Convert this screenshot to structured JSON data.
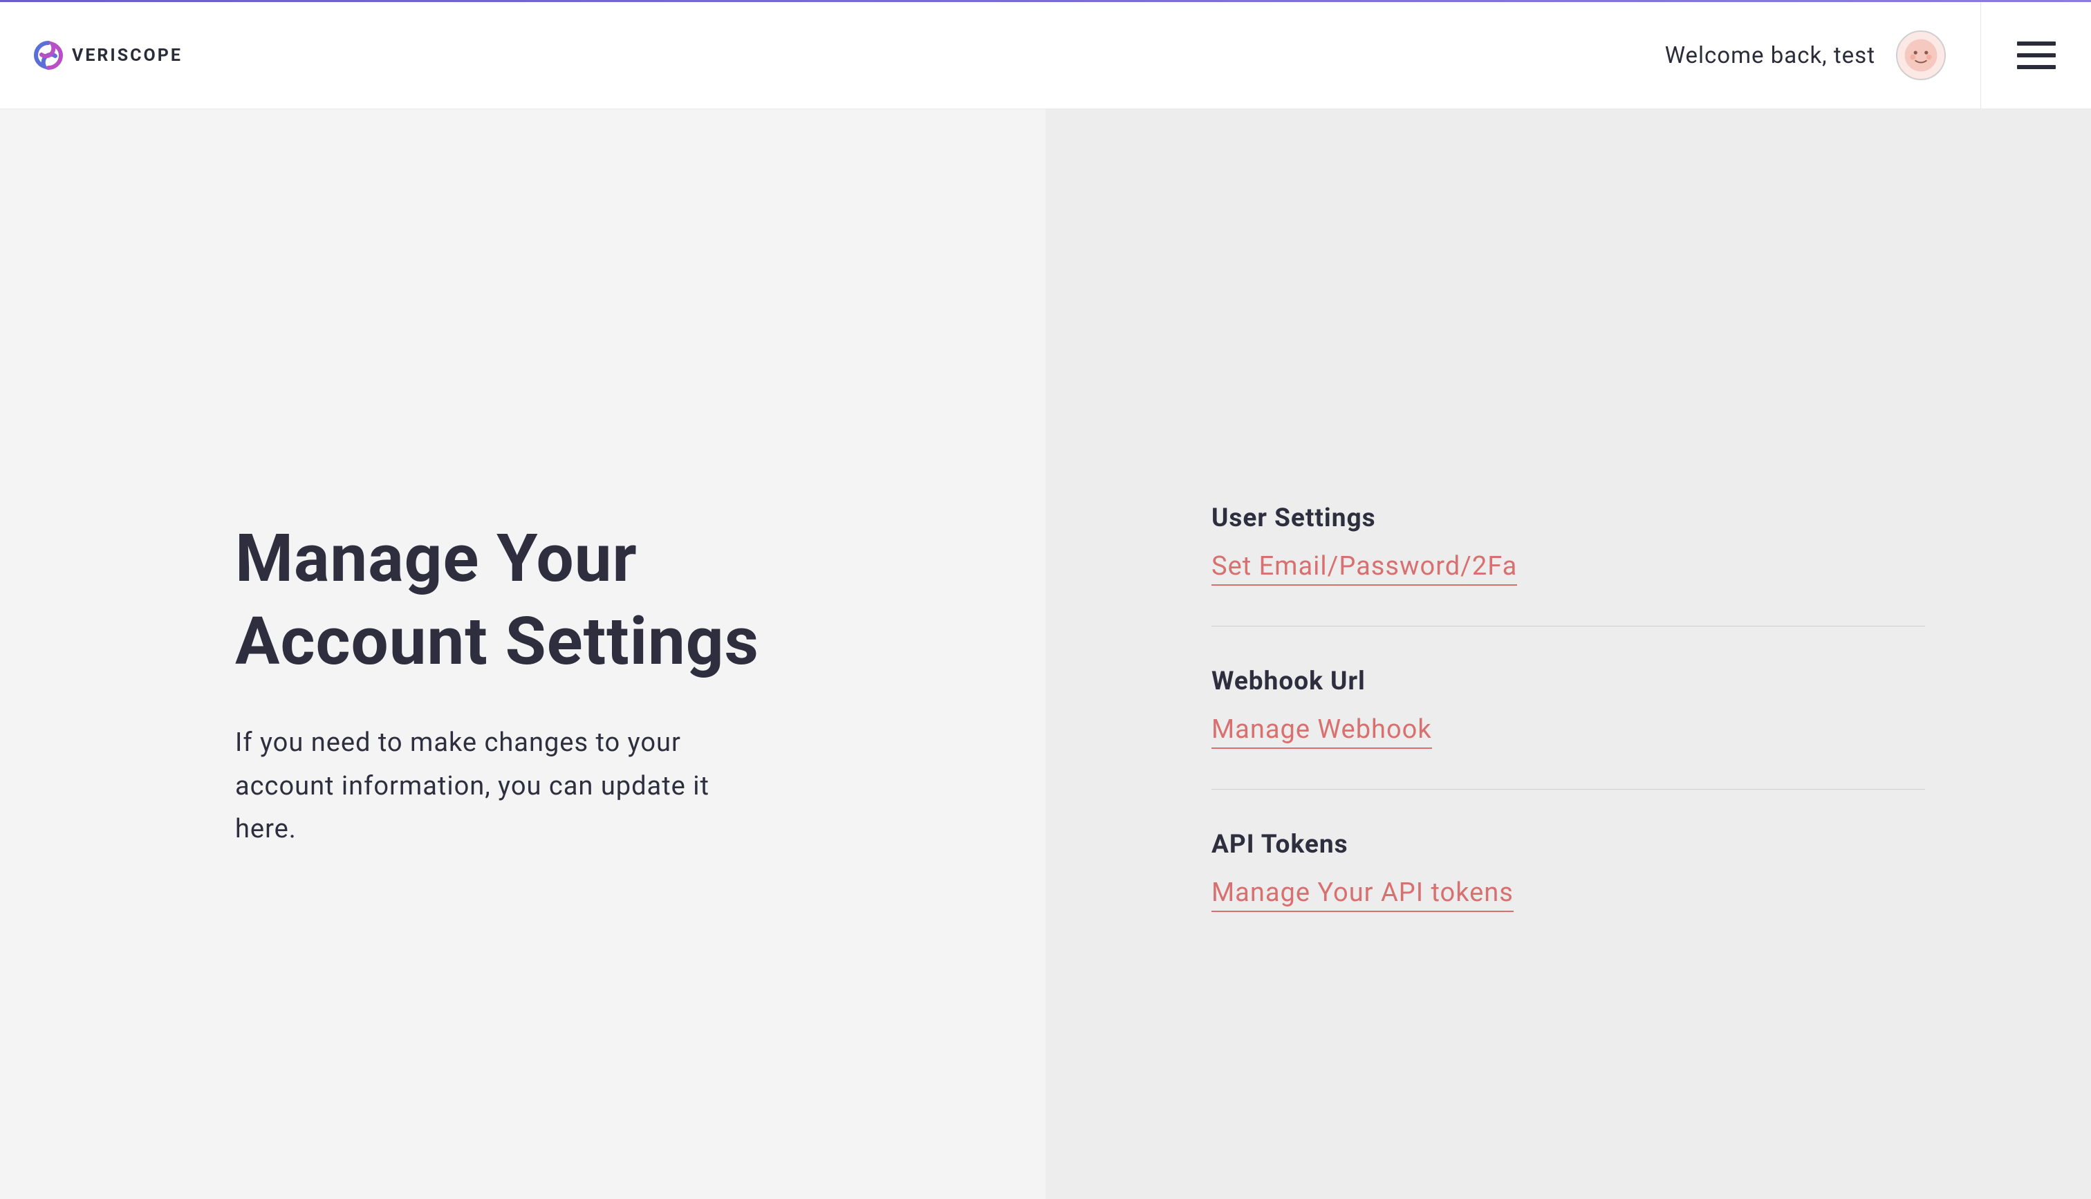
{
  "brand": {
    "name": "VERISCOPE"
  },
  "header": {
    "welcome_text": "Welcome back, test"
  },
  "main": {
    "title": "Manage Your Account Settings",
    "description": "If you need to make changes to your account information, you can update it here."
  },
  "settings": {
    "sections": [
      {
        "title": "User Settings",
        "link_label": "Set Email/Password/2Fa"
      },
      {
        "title": "Webhook Url",
        "link_label": "Manage Webhook"
      },
      {
        "title": "API Tokens",
        "link_label": "Manage Your API tokens"
      }
    ]
  }
}
